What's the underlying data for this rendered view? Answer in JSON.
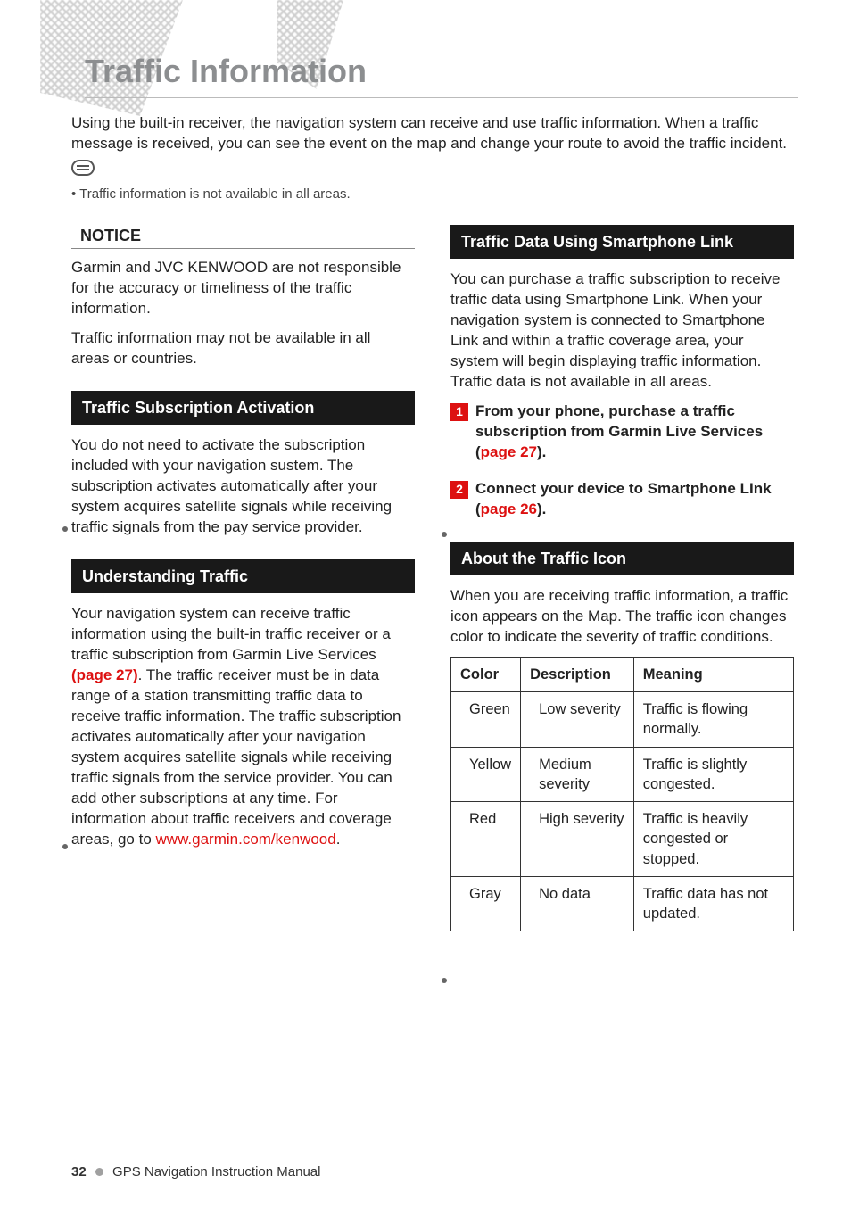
{
  "title": "Traffic Information",
  "intro": {
    "body": "Using the built-in receiver, the navigation system can receive and use traffic information. When a traffic message is received, you can see the event on the map and change your route to avoid the traffic incident.",
    "note": "• Traffic information is not available in all areas."
  },
  "left": {
    "notice": {
      "heading": "NOTICE",
      "p1": "Garmin and JVC KENWOOD are not responsible for the accuracy or timeliness of the traffic information.",
      "p2": "Traffic information may not be available in all areas or countries."
    },
    "activation": {
      "heading": "Traffic Subscription Activation",
      "body": "You do not need to activate the subscription included with your navigation sustem. The subscription activates automatically after your system acquires satellite signals while receiving traffic signals from the pay service provider."
    },
    "understanding": {
      "heading": "Understanding Traffic",
      "body_pre": "Your navigation system can receive traffic information using the built-in traffic receiver or a traffic subscription from Garmin Live Services ",
      "link1": "(page 27)",
      "body_mid": ". The traffic receiver must be in data range of a station transmitting traffic data to receive traffic information. The traffic subscription activates automatically after your navigation system acquires satellite signals while receiving traffic signals from the service provider. You can add other subscriptions at any time. For information about traffic receivers and coverage areas, go to ",
      "link2": "www.garmin.com/kenwood",
      "body_post": "."
    }
  },
  "right": {
    "smartphone": {
      "heading": "Traffic Data Using Smartphone Link",
      "body": "You can purchase a traffic subscription to receive traffic data using Smartphone Link. When your navigation system is connected to Smartphone Link and within a traffic coverage area, your system will begin displaying traffic information. Traffic data is not available in all areas.",
      "step1_num": "1",
      "step1_a": "From your phone, purchase a traffic subscription from Garmin Live Services (",
      "step1_link": "page 27",
      "step1_b": ").",
      "step2_num": "2",
      "step2_a": "Connect your device to Smartphone LInk (",
      "step2_link": "page 26",
      "step2_b": ")."
    },
    "icon": {
      "heading": "About the Traffic Icon",
      "body": "When you are receiving traffic information, a traffic icon appears on the Map. The traffic icon changes color to indicate the severity of traffic conditions."
    },
    "table": {
      "headers": {
        "c1": "Color",
        "c2": "Description",
        "c3": "Meaning"
      },
      "rows": [
        {
          "c1": "Green",
          "c2": "Low severity",
          "c3": "Traffic is flowing normally."
        },
        {
          "c1": "Yellow",
          "c2": "Medium severity",
          "c3": "Traffic is slightly congested."
        },
        {
          "c1": "Red",
          "c2": "High severity",
          "c3": "Traffic is heavily congested or stopped."
        },
        {
          "c1": "Gray",
          "c2": "No data",
          "c3": "Traffic data has not updated."
        }
      ]
    }
  },
  "footer": {
    "page": "32",
    "title": "GPS Navigation Instruction Manual"
  }
}
